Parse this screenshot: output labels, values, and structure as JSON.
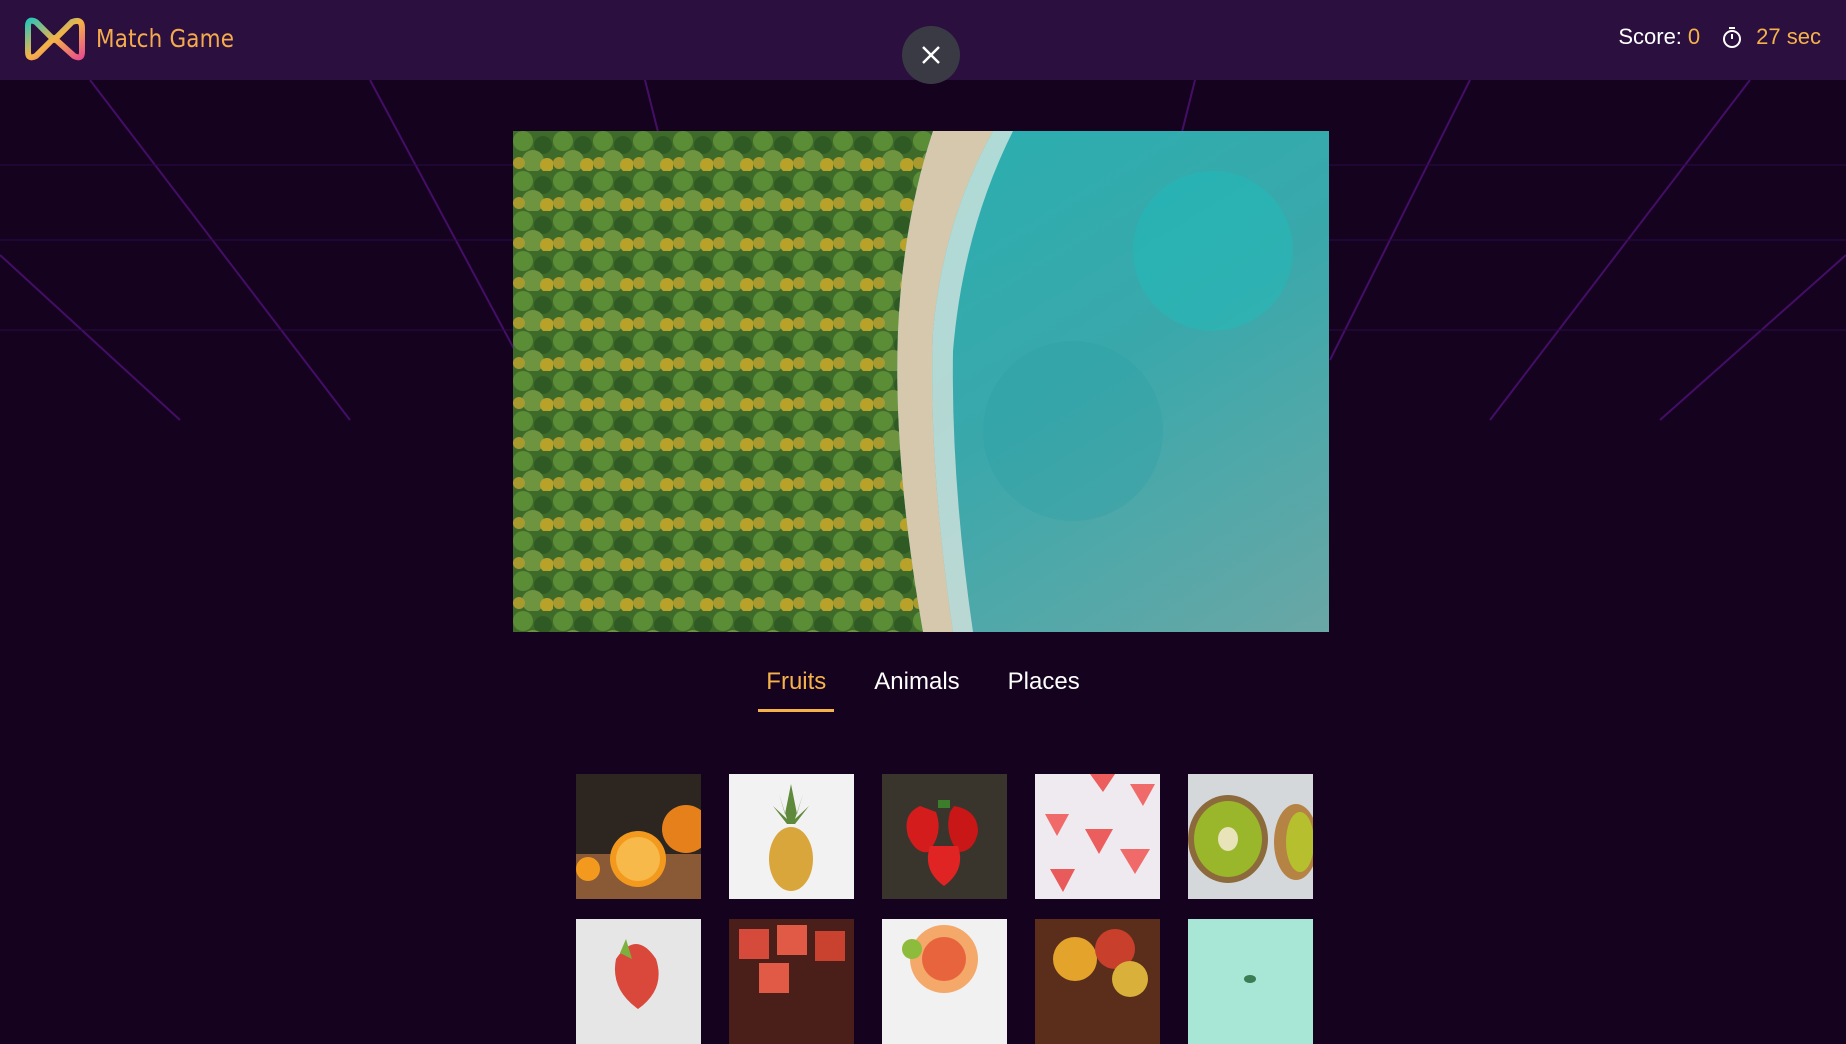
{
  "app": {
    "title": "Match Game"
  },
  "stats": {
    "score_label": "Score:",
    "score_value": "0",
    "timer_value": "27 sec"
  },
  "tabs": [
    {
      "label": "Fruits",
      "active": true
    },
    {
      "label": "Animals",
      "active": false
    },
    {
      "label": "Places",
      "active": false
    }
  ],
  "colors": {
    "accent": "#f6b24a",
    "topbar": "#2a0f3f",
    "background": "#14021f"
  }
}
